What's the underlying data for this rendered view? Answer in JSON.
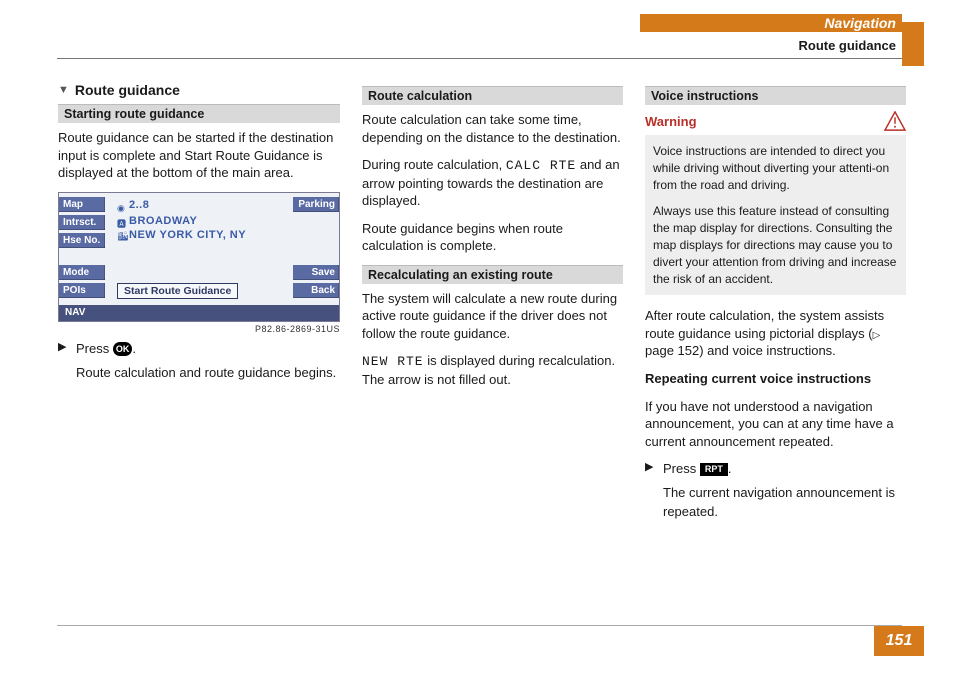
{
  "header": {
    "main": "Navigation",
    "sub": "Route guidance"
  },
  "page_number": "151",
  "section_title": "Route guidance",
  "col1": {
    "sub1": "Starting route guidance",
    "p1": "Route guidance can be started if the destination input is complete and Start Route Guidance is displayed at the bottom of the main area.",
    "step_press": "Press ",
    "step_press_after": ".",
    "step_indent": "Route calculation and route guidance begins.",
    "fig": {
      "map": "Map",
      "intrsct": "Intrsct.",
      "hseno": "Hse No.",
      "mode": "Mode",
      "pois": "POIs",
      "parking": "Parking",
      "save": "Save",
      "back": "Back",
      "addr_num": "2..8",
      "addr_road": "BROADWAY",
      "addr_city": "NEW YORK CITY, NY",
      "srg": "Start Route Guidance",
      "footer": "NAV",
      "caption": "P82.86-2869-31US"
    }
  },
  "col2": {
    "sub1": "Route calculation",
    "p1": "Route calculation can take some time, depending on the distance to the destination.",
    "p2a": "During route calculation, ",
    "p2m": "CALC RTE",
    "p2b": " and an arrow pointing towards the destination are displayed.",
    "p3": "Route guidance begins when route calculation is complete.",
    "sub2": "Recalculating an existing route",
    "p4": "The system will calculate a new route during active route guidance if the driver does not follow the route guidance.",
    "p5m": "NEW RTE",
    "p5b": " is displayed during recalculation. The arrow is not filled out."
  },
  "col3": {
    "sub1": "Voice instructions",
    "warn_label": "Warning",
    "warn_p1": "Voice instructions are intended to direct you while driving without diverting your attenti-on from the road and driving.",
    "warn_p2": "Always use this feature instead of consulting the map display for directions. Consulting the map displays for directions may cause you to divert your attention from driving and increase the risk of an accident.",
    "after_p_a": "After route calculation, the system assists route guidance using pictorial displays (",
    "after_p_x": " page 152",
    "after_p_b": ") and voice instructions.",
    "sub2": "Repeating current voice instructions",
    "p2": "If you have not understood a navigation announcement, you can at any time have a current announcement repeated.",
    "step_press": "Press ",
    "step_press_after": ".",
    "step_indent": "The current navigation announcement is repeated.",
    "rpt_label": "RPT",
    "ok_label": "OK"
  }
}
